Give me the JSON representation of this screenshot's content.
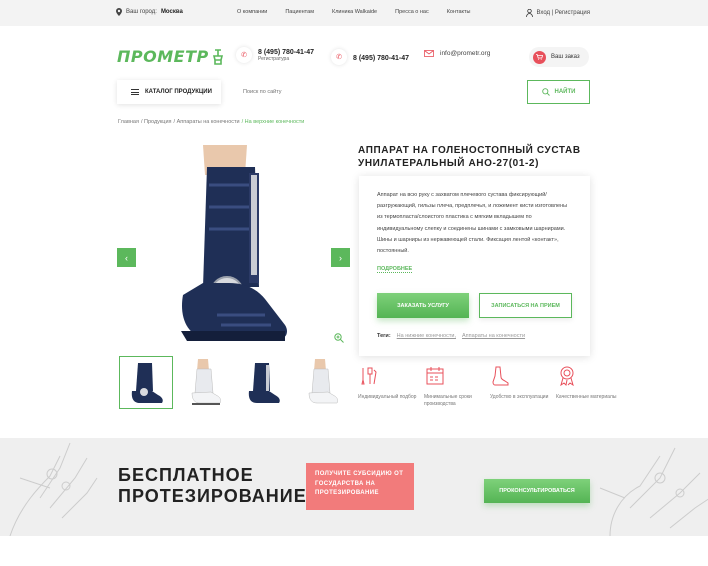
{
  "topbar": {
    "city_label": "Ваш город:",
    "city_value": "Москва",
    "nav": [
      "О компании",
      "Пациентам",
      "Клиника Walkaide",
      "Пресса о нас",
      "Контакты"
    ],
    "login": "Вход | Регистрация"
  },
  "header": {
    "logo_text": "ПРОМЕТР",
    "phone1": {
      "number": "8 (495) 780-41-47",
      "caption": "Регистратура"
    },
    "phone2": {
      "number": "8 (495) 780-41-47"
    },
    "email": "info@prometr.org",
    "order_label": "Ваш заказ"
  },
  "search": {
    "catalog_label": "КАТАЛОГ ПРОДУКЦИИ",
    "placeholder": "Поиск по сайту",
    "button_label": "НАЙТИ"
  },
  "breadcrumb": [
    "Главная",
    "/ Продукция",
    "/ Аппараты на конечности",
    "/ На верхние конечности"
  ],
  "product": {
    "title": "АППАРАТ НА ГОЛЕНОСТОПНЫЙ СУСТАВ УНИЛАТЕРАЛЬНЫЙ АНО-27(01-2)",
    "description": "Аппарат на всю руку с захватом плечевого сустава фиксирующий/разгружающий, гильзы плеча, предплечья, и ложемент кисти изготовлены из термопласта/слоистого пластика с мягким вкладышем по индивидуальному слепку и соединены шинами с замковыми шарнирами. Шины и шарниры из нержавеющей стали. Фиксация лентой «контакт», постоянный.",
    "more_label": "ПОДРОБНЕЕ",
    "order_button": "ЗАКАЗАТЬ УСЛУГУ",
    "appointment_button": "ЗАПИСАТЬСЯ НА ПРИЕМ",
    "tags_label": "Теги:",
    "tags": [
      "На нижние конечности,",
      "Аппараты на конечности"
    ]
  },
  "features": [
    {
      "icon": "tools-icon",
      "label": "Индивидуальный подбор"
    },
    {
      "icon": "calendar-icon",
      "label": "Минимальные сроки производства"
    },
    {
      "icon": "foot-icon",
      "label": "Удобство в эксплуатации"
    },
    {
      "icon": "medal-icon",
      "label": "Качественные материалы"
    }
  ],
  "banner": {
    "headline_line1": "БЕСПЛАТНОЕ",
    "headline_line2": "ПРОТЕЗИРОВАНИЕ!",
    "subsidy_text": "ПОЛУЧИТЕ СУБСИДИЮ ОТ ГОСУДАРСТВА НА ПРОТЕЗИРОВАНИЕ",
    "consult_button": "ПРОКОНСУЛЬТИРОВАТЬСЯ"
  },
  "colors": {
    "accent": "#5cb85c",
    "red": "#e8505b",
    "pink": "#f27b7b",
    "boot": "#1f2f56"
  }
}
